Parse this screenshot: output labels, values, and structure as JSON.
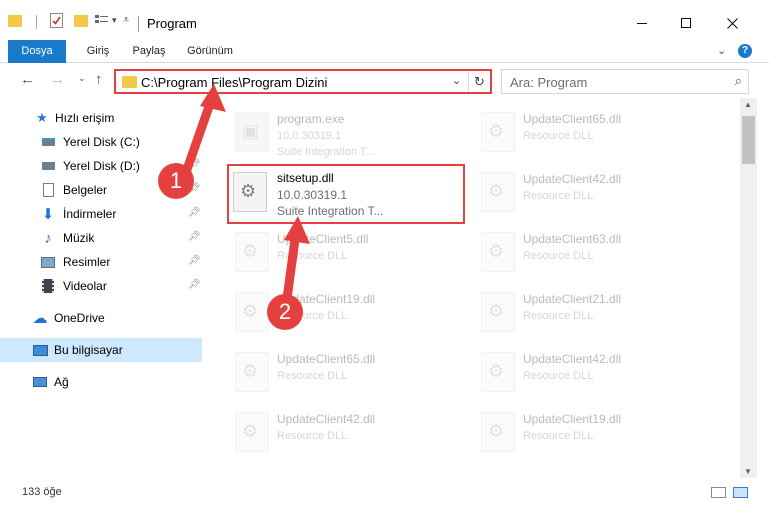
{
  "window": {
    "title": "Program",
    "minimize_icon": "minimize-icon",
    "maximize_icon": "maximize-icon",
    "close_icon": "close-icon"
  },
  "ribbon": {
    "tabs": [
      {
        "label": "Dosya"
      },
      {
        "label": "Giriş"
      },
      {
        "label": "Paylaş"
      },
      {
        "label": "Görünüm"
      }
    ],
    "help_label": "?"
  },
  "address_bar": {
    "path": "C:\\Program Files\\Program Dizini"
  },
  "search": {
    "placeholder": "Ara: Program"
  },
  "sidebar": {
    "quick_access": "Hızlı erişim",
    "items": [
      {
        "label": "Yerel Disk (C:)",
        "icon": "drive-icon"
      },
      {
        "label": "Yerel Disk (D:)",
        "icon": "drive-icon"
      },
      {
        "label": "Belgeler",
        "icon": "documents-icon"
      },
      {
        "label": "İndirmeler",
        "icon": "downloads-icon"
      },
      {
        "label": "Müzik",
        "icon": "music-icon"
      },
      {
        "label": "Resimler",
        "icon": "pictures-icon"
      },
      {
        "label": "Videolar",
        "icon": "videos-icon"
      }
    ],
    "onedrive": "OneDrive",
    "this_pc": "Bu bilgisayar",
    "network": "Ağ"
  },
  "files": [
    {
      "name": "program.exe",
      "line1": "10.0.30319.1",
      "line2": "Suite Integration T..."
    },
    {
      "name": "UpdateClient65.dll",
      "line1": "Resource DLL"
    },
    {
      "name": "sitsetup.dll",
      "line1": "10.0.30319.1",
      "line2": "Suite Integration T..."
    },
    {
      "name": "UpdateClient42.dll",
      "line1": "Resource DLL"
    },
    {
      "name": "UpdateClient5.dll",
      "line1": "Resource DLL"
    },
    {
      "name": "UpdateClient63.dll",
      "line1": "Resource DLL"
    },
    {
      "name": "UpdateClient19.dll",
      "line1": "Resource DLL"
    },
    {
      "name": "UpdateClient21.dll",
      "line1": "Resource DLL"
    },
    {
      "name": "UpdateClient65.dll",
      "line1": "Resource DLL"
    },
    {
      "name": "UpdateClient42.dll",
      "line1": "Resource DLL"
    },
    {
      "name": "UpdateClient42.dll",
      "line1": "Resource DLL"
    },
    {
      "name": "UpdateClient19.dll",
      "line1": "Resource DLL"
    }
  ],
  "status": {
    "count": "133 öğe"
  },
  "annotations": {
    "step1": "1",
    "step2": "2"
  },
  "colors": {
    "accent": "#1979ca",
    "highlight": "#e4403f",
    "selected": "#cde8ff"
  }
}
